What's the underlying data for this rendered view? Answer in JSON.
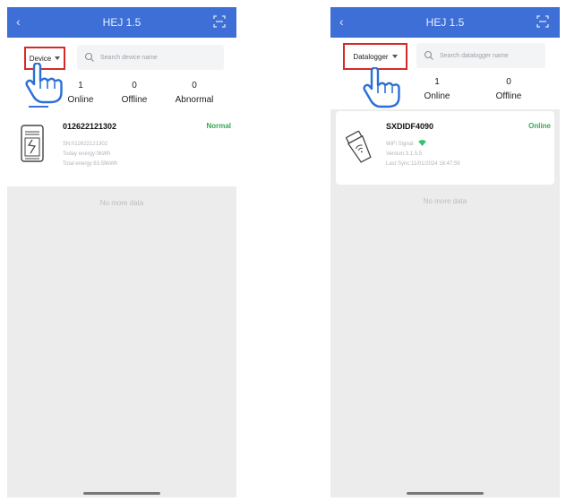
{
  "colors": {
    "accent": "#3d6fd6",
    "highlight": "#d62a2a",
    "online": "#35a853"
  },
  "left": {
    "header": {
      "back_icon": "chevron-left-icon",
      "title": "HEJ 1.5",
      "scan_icon": "scan-icon"
    },
    "dropdown": {
      "label": "Device"
    },
    "search": {
      "placeholder": "Search device name"
    },
    "counts": [
      {
        "value": "1",
        "label": "Online"
      },
      {
        "value": "0",
        "label": "Offline"
      },
      {
        "value": "0",
        "label": "Abnormal"
      }
    ],
    "device": {
      "name": "012622121302",
      "status": "Normal",
      "sn": "SN:012622121302",
      "today_energy": "Today energy:0kWh",
      "total_energy": "Total energy:63.59kWh"
    },
    "no_more": "No more data"
  },
  "right": {
    "header": {
      "back_icon": "chevron-left-icon",
      "title": "HEJ 1.5",
      "scan_icon": "scan-icon"
    },
    "dropdown": {
      "label": "Datalogger"
    },
    "search": {
      "placeholder": "Search datalogger name"
    },
    "counts": [
      {
        "value": "1",
        "label": "Online"
      },
      {
        "value": "0",
        "label": "Offline"
      }
    ],
    "device": {
      "name": "SXDIDF4090",
      "status": "Online",
      "wifi": "WiFi Signal:",
      "version": "Version:3.1.5.5",
      "last_sync": "Last Sync:11/01/2024 16:47:59"
    },
    "no_more": "No more data"
  }
}
